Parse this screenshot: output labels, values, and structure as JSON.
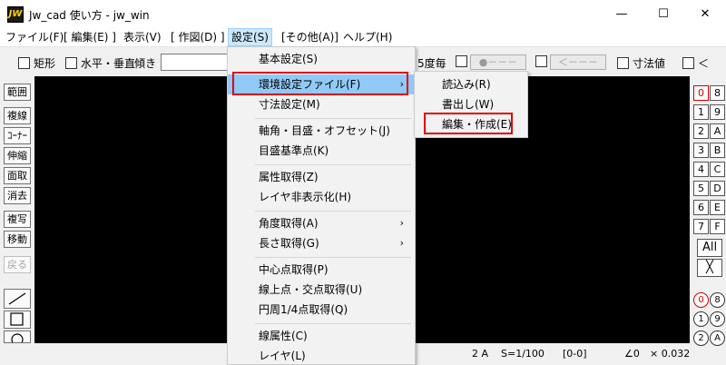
{
  "window": {
    "title": "Jw_cad 使い方 - jw_win",
    "icon_text": "JW",
    "minimize": "—",
    "maximize": "☐",
    "close": "✕"
  },
  "menubar": {
    "items": [
      "ファイル(F)",
      "[ 編集(E) ]",
      "表示(V)",
      "[ 作図(D) ]",
      "設定(S)",
      "[その他(A)]",
      "ヘルプ(H)"
    ]
  },
  "toolbar": {
    "rect_label": "矩形",
    "hv_label": "水平・垂直",
    "tilt_label": "傾き",
    "tilt_value": "",
    "degree_label": "5度毎",
    "point_label": "●－－－",
    "arrow_label": "＜－－－",
    "dim_label": "寸法値",
    "lt_label": "＜"
  },
  "left_tools": [
    "範囲",
    "複線",
    "ｺｰﾅｰ",
    "伸縮",
    "面取",
    "消去",
    "複写",
    "移動",
    "戻る"
  ],
  "left_shapes": [
    "line-icon",
    "square-icon",
    "circle-icon"
  ],
  "right_tools": {
    "boxes_left": [
      "0",
      "1",
      "2",
      "3",
      "4",
      "5",
      "6",
      "7"
    ],
    "boxes_right": [
      "8",
      "9",
      "A",
      "B",
      "C",
      "D",
      "E",
      "F"
    ],
    "all_label": "All",
    "x_label": "╳",
    "circles_left": [
      "0",
      "1",
      "2"
    ],
    "circles_right": [
      "8",
      "9",
      "A"
    ]
  },
  "statusbar": {
    "layer": "2 A",
    "scale": "S=1/100",
    "group": "[0-0]",
    "angle": "∠0",
    "mult": "× 0.032"
  },
  "settings_menu": {
    "items": [
      {
        "label": "基本設定(S)",
        "arrow": ""
      },
      {
        "label": "環境設定ファイル(F)",
        "arrow": "›"
      },
      {
        "label": "寸法設定(M)",
        "arrow": ""
      },
      {
        "label": "軸角・目盛・オフセット(J)",
        "arrow": ""
      },
      {
        "label": "目盛基準点(K)",
        "arrow": ""
      },
      {
        "label": "属性取得(Z)",
        "arrow": ""
      },
      {
        "label": "レイヤ非表示化(H)",
        "arrow": ""
      },
      {
        "label": "角度取得(A)",
        "arrow": "›"
      },
      {
        "label": "長さ取得(G)",
        "arrow": "›"
      },
      {
        "label": "中心点取得(P)",
        "arrow": ""
      },
      {
        "label": "線上点・交点取得(U)",
        "arrow": ""
      },
      {
        "label": "円周1/4点取得(Q)",
        "arrow": ""
      },
      {
        "label": "線属性(C)",
        "arrow": ""
      },
      {
        "label": "レイヤ(L)",
        "arrow": ""
      }
    ]
  },
  "env_submenu": {
    "items": [
      "読込み(R)",
      "書出し(W)",
      "編集・作成(E)"
    ]
  },
  "colors": {
    "highlight": "#91c9f7",
    "callout": "#e00000",
    "canvas": "#000000"
  }
}
